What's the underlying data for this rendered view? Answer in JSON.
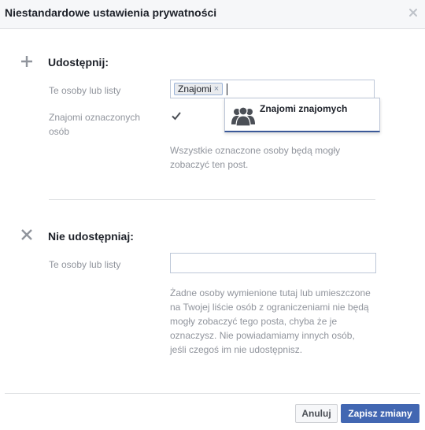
{
  "dialog": {
    "title": "Niestandardowe ustawienia prywatności",
    "close_icon": "close-icon"
  },
  "share": {
    "icon": "plus-icon",
    "heading": "Udostępnij:",
    "people_label": "Te osoby lub listy",
    "tokens": [
      {
        "label": "Znajomi",
        "remove_glyph": "×"
      }
    ],
    "typeahead": {
      "icon": "people-group-icon",
      "label": "Znajomi znajomych"
    },
    "tagged_friends_label_line1": "Znajomi oznaczonych",
    "tagged_friends_label_line2": "osób",
    "tagged_friends_checked": true,
    "help_line1": "Wszystkie oznaczone osoby będą mogły",
    "help_line2": "zobaczyć ten post."
  },
  "dont_share": {
    "icon": "x-icon",
    "heading": "Nie udostępniaj:",
    "people_label": "Te osoby lub listy",
    "input_value": "",
    "help_line1": "Żadne osoby wymienione tutaj lub umieszczone",
    "help_line2": "na Twojej liście osób z ograniczeniami nie będą",
    "help_line3": "mogły zobaczyć tego posta, chyba że je",
    "help_line4": "oznaczysz. Nie powiadamiamy innych osób,",
    "help_line5": "jeśli czegoś im nie udostępnisz."
  },
  "footer": {
    "cancel_label": "Anuluj",
    "save_label": "Zapisz zmiany"
  },
  "colors": {
    "primary": "#4267b2",
    "border": "#bdc7d8",
    "muted_text": "#90949c"
  }
}
